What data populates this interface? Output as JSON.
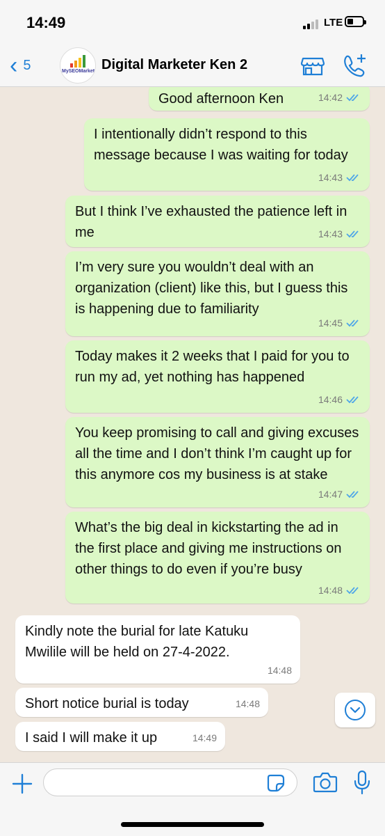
{
  "status": {
    "time": "14:49",
    "network": "LTE"
  },
  "header": {
    "back_count": "5",
    "contact_name": "Digital Marketer Ken 2",
    "avatar_logo_text": "MySEOMarket"
  },
  "messages": [
    {
      "text": "Good afternoon Ken",
      "time": "14:42",
      "direction": "outgoing"
    },
    {
      "text": "I intentionally didn’t respond to this message because I was waiting for today",
      "time": "14:43",
      "direction": "outgoing"
    },
    {
      "text": "But I think I’ve exhausted the patience left in me",
      "time": "14:43",
      "direction": "outgoing"
    },
    {
      "text": "I’m very sure you wouldn’t deal with an organization (client) like this, but I guess this is happening due to familiarity",
      "time": "14:45",
      "direction": "outgoing"
    },
    {
      "text": "Today makes it 2 weeks that I paid for you to run my ad, yet nothing has happened",
      "time": "14:46",
      "direction": "outgoing"
    },
    {
      "text": "You keep promising to call and giving excuses all the time and I don’t think I’m caught up for this anymore cos my business is at stake",
      "time": "14:47",
      "direction": "outgoing"
    },
    {
      "text": "What’s the big deal in kickstarting the ad in the first place and giving me instructions on other things to do even if you’re busy",
      "time": "14:48",
      "direction": "outgoing"
    },
    {
      "text": "Kindly note the burial for late Katuku Mwilile will be held on 27-4-2022.",
      "time": "14:48",
      "direction": "incoming"
    },
    {
      "text": "Short notice burial is today",
      "time": "14:48",
      "direction": "incoming"
    },
    {
      "text": "I said I will make it up",
      "time": "14:49",
      "direction": "incoming"
    }
  ],
  "composer": {
    "text": ""
  },
  "colors": {
    "accent": "#1f7fd6",
    "outgoing_bubble": "#dcf8c6",
    "incoming_bubble": "#ffffff",
    "chat_background": "#efe7de",
    "read_ticks": "#4fa6e8"
  }
}
